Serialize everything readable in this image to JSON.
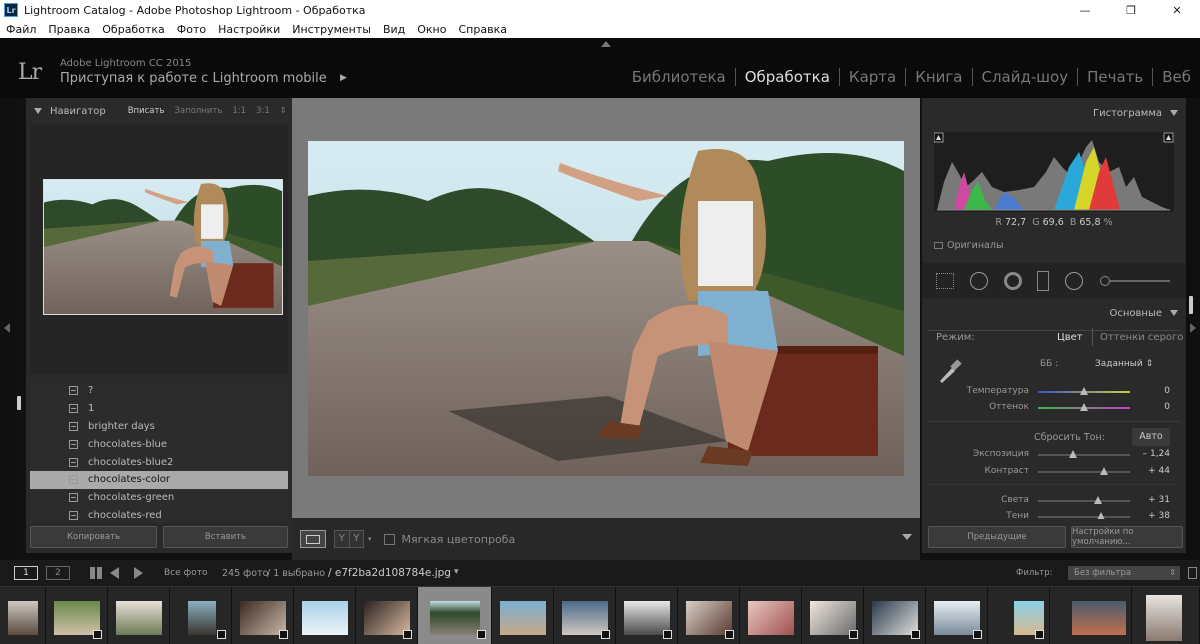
{
  "window": {
    "title": "Lightroom Catalog - Adobe Photoshop Lightroom - Обработка",
    "logo": "Lr",
    "minimize": "—",
    "maximize": "❐",
    "close": "✕"
  },
  "menu": [
    "Файл",
    "Правка",
    "Обработка",
    "Фото",
    "Настройки",
    "Инструменты",
    "Вид",
    "Окно",
    "Справка"
  ],
  "identity": {
    "logo": "Lr",
    "app": "Adobe Lightroom CC 2015",
    "mobile": "Приступая к работе с Lightroom mobile"
  },
  "modules": [
    {
      "label": "Библиотека",
      "active": false
    },
    {
      "label": "Обработка",
      "active": true
    },
    {
      "label": "Карта",
      "active": false
    },
    {
      "label": "Книга",
      "active": false
    },
    {
      "label": "Слайд-шоу",
      "active": false
    },
    {
      "label": "Печать",
      "active": false
    },
    {
      "label": "Веб",
      "active": false
    }
  ],
  "navigator": {
    "title": "Навигатор",
    "options": [
      "Вписать",
      "Заполнить",
      "1:1",
      "3:1"
    ],
    "arrows": "⇕"
  },
  "presets": [
    "?",
    "1",
    "brighter days",
    "chocolates-blue",
    "chocolates-blue2",
    "chocolates-color",
    "chocolates-green",
    "chocolates-red"
  ],
  "presets_selected": "chocolates-color",
  "left_buttons": {
    "copy": "Копировать",
    "paste": "Вставить"
  },
  "toolbar": {
    "view1": "Y",
    "view2": "Y",
    "softproof": "Мягкая цветопроба"
  },
  "histogram": {
    "title": "Гистограмма",
    "r_label": "R",
    "r": "72,7",
    "g_label": "G",
    "g": "69,6",
    "b_label": "B",
    "b": "65,8",
    "pct": "%",
    "originals": "Оригиналы"
  },
  "basic": {
    "title": "Основные",
    "mode_label": "Режим:",
    "mode_color": "Цвет",
    "mode_gray": "Оттенки серого",
    "wb_label": "ББ :",
    "wb_value": "Заданный ⇕",
    "temp_label": "Температура",
    "temp_val": "0",
    "temp": 0,
    "tint_label": "Оттенок",
    "tint_val": "0",
    "tint": 0,
    "reset_label": "Сбросить Тон:",
    "auto": "Авто",
    "exposure_label": "Экспозиция",
    "exposure_val": "– 1,24",
    "exposure": -1.24,
    "contrast_label": "Контраст",
    "contrast_val": "+ 44",
    "contrast": 44,
    "highlights_label": "Света",
    "highlights_val": "+ 31",
    "highlights": 31,
    "shadows_label": "Тени",
    "shadows_val": "+ 38",
    "shadows": 38
  },
  "right_buttons": {
    "prev": "Предыдущие",
    "defaults": "Настройки по умолчанию..."
  },
  "filmbar": {
    "tab1": "1",
    "tab2": "2",
    "all_photos": "Все фото",
    "count": "245 фото",
    "selected": "/ 1 выбрано",
    "file": "/ e7f2ba2d108784e.jpg",
    "file_arrow": "▾",
    "filter_label": "Фильтр:",
    "filter_value": "Без фильтра"
  },
  "colors": {
    "bg": "#111111",
    "panel": "#2a2a2a",
    "center": "#7a7a7a",
    "active_text": "#dddddd"
  }
}
